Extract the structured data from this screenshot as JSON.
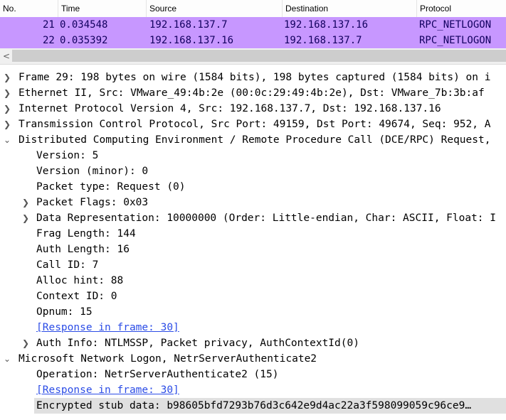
{
  "packet_list": {
    "columns": [
      "No.",
      "Time",
      "Source",
      "Destination",
      "Protocol"
    ],
    "rows": [
      {
        "no": "21",
        "time": "0.034548",
        "source": "192.168.137.7",
        "destination": "192.168.137.16",
        "protocol": "RPC_NETLOGON"
      },
      {
        "no": "22",
        "time": "0.035392",
        "source": "192.168.137.16",
        "destination": "192.168.137.7",
        "protocol": "RPC_NETLOGON"
      }
    ],
    "row_color": "#c797ff",
    "scroll_left_arrow": "<"
  },
  "details": {
    "frame": "Frame 29: 198 bytes on wire (1584 bits), 198 bytes captured (1584 bits) on i",
    "ethernet": "Ethernet II, Src: VMware_49:4b:2e (00:0c:29:49:4b:2e), Dst: VMware_7b:3b:af",
    "ip": "Internet Protocol Version 4, Src: 192.168.137.7, Dst: 192.168.137.16",
    "tcp": "Transmission Control Protocol, Src Port: 49159, Dst Port: 49674, Seq: 952, A",
    "dcerpc": {
      "title": "Distributed Computing Environment / Remote Procedure Call (DCE/RPC) Request,",
      "version": "Version: 5",
      "version_minor": "Version (minor): 0",
      "packet_type": "Packet type: Request (0)",
      "packet_flags": "Packet Flags: 0x03",
      "data_representation": "Data Representation: 10000000 (Order: Little-endian, Char: ASCII, Float: I",
      "frag_length": "Frag Length: 144",
      "auth_length": "Auth Length: 16",
      "call_id": "Call ID: 7",
      "alloc_hint": "Alloc hint: 88",
      "context_id": "Context ID: 0",
      "opnum": "Opnum: 15",
      "response_link": "[Response in frame: 30]",
      "auth_info": "Auth Info: NTLMSSP, Packet privacy, AuthContextId(0)"
    },
    "netlogon": {
      "title": "Microsoft Network Logon, NetrServerAuthenticate2",
      "operation": "Operation: NetrServerAuthenticate2 (15)",
      "response_link": "[Response in frame: 30]",
      "stub": "Encrypted stub data: b98605bfd7293b76d3c642e9d4ac22a3f598099059c96ce9…"
    },
    "icons": {
      "collapsed": "chevron-right-icon",
      "expanded": "chevron-down-icon"
    }
  }
}
